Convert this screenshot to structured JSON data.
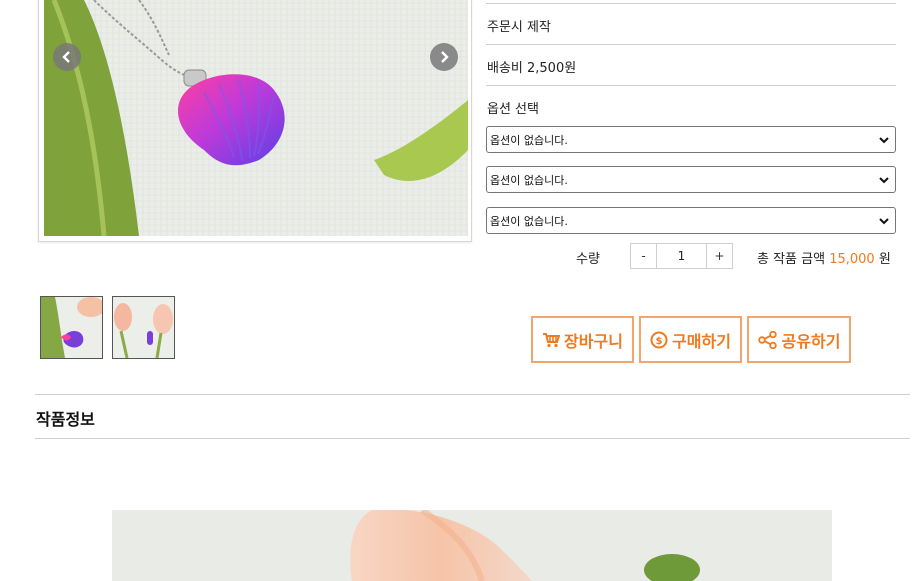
{
  "product_info": {
    "production": "주문시 제작",
    "shipping": "배송비 2,500원",
    "options_label": "옵션 선택",
    "options": [
      {
        "selected": "옵션이 없습니다."
      },
      {
        "selected": "옵션이 없습니다."
      },
      {
        "selected": "옵션이 없습니다."
      }
    ]
  },
  "quantity": {
    "label": "수량",
    "minus": "-",
    "value": "1",
    "plus": "+"
  },
  "total": {
    "label": "총 작품 금액",
    "amount": "15,000",
    "unit": "원",
    "amount_color": "#f07a1f"
  },
  "actions": {
    "cart": "장바구니",
    "buy": "구매하기",
    "share": "공유하기",
    "accent_color": "#f07a1f"
  },
  "section": {
    "title": "작품정보"
  },
  "icons": {
    "prev": "chevron-left-icon",
    "next": "chevron-right-icon",
    "cart": "cart-icon",
    "buy": "coin-icon",
    "share": "share-icon"
  }
}
